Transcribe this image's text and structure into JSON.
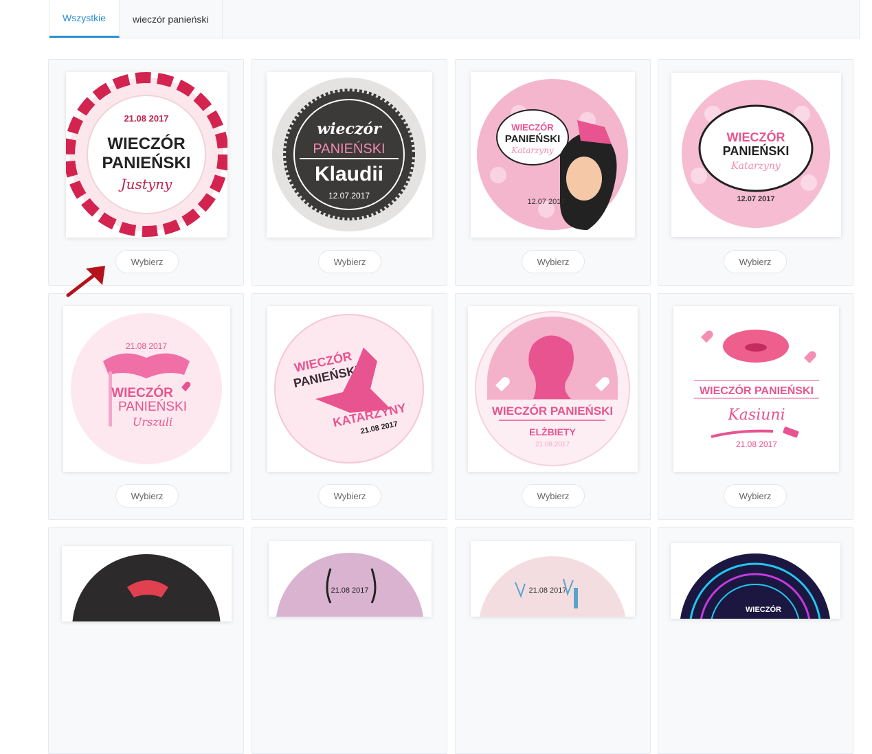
{
  "tabs": [
    {
      "label": "Wszystkie",
      "active": true
    },
    {
      "label": "wieczór panieński",
      "active": false
    }
  ],
  "select_label": "Wybierz",
  "cards": [
    {
      "date": "21.08 2017",
      "line1": "WIECZÓR",
      "line2": "PANIEŃSKI",
      "name": "Justyny"
    },
    {
      "line1": "wieczór",
      "line2": "PANIEŃSKI",
      "name": "Klaudii",
      "date": "12.07.2017"
    },
    {
      "line1": "WIECZÓR",
      "line2": "PANIEŃSKI",
      "name": "Katarzyny",
      "date": "12.07 2017"
    },
    {
      "line1": "WIECZÓR",
      "line2": "PANIEŃSKI",
      "name": "Katarzyny",
      "date": "12.07 2017"
    },
    {
      "date": "21.08 2017",
      "line1": "WIECZÓR",
      "line2": "PANIEŃSKI",
      "name": "Urszuli"
    },
    {
      "line1": "WIECZÓR",
      "line2": "PANIEŃSKI",
      "name": "KATARZYNY",
      "date": "21.08 2017"
    },
    {
      "line1": "WIECZÓR PANIEŃSKI",
      "name": "ELŻBIETY",
      "date": "21.08.2017"
    },
    {
      "line1": "WIECZÓR PANIEŃSKI",
      "name": "Kasiuni",
      "date": "21.08 2017"
    },
    {},
    {
      "date": "21.08 2017"
    },
    {
      "date": "21.08 2017"
    },
    {
      "line1": "WIECZÓR"
    }
  ],
  "colors": {
    "accent": "#2a8fd4",
    "pink": "#e8548f",
    "arrow": "#b5121b"
  }
}
